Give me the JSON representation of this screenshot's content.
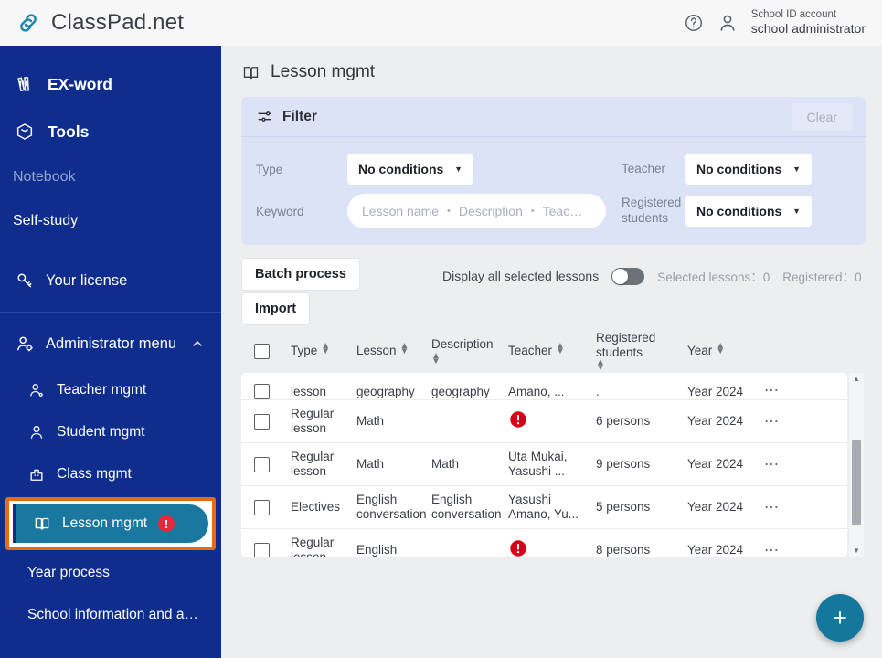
{
  "topbar": {
    "brand_name": "ClassPad.net",
    "help_icon": "help-circle-icon",
    "account_icon": "user-icon",
    "account_type": "School ID account",
    "account_name": "school administrator"
  },
  "sidebar": {
    "primary": [
      {
        "label": "EX-word",
        "icon": "books-icon"
      },
      {
        "label": "Tools",
        "icon": "toolbox-icon"
      }
    ],
    "notebook_label": "Notebook",
    "selfstudy_label": "Self-study",
    "license": {
      "label": "Your license",
      "icon": "key-icon"
    },
    "admin_group": {
      "label": "Administrator menu",
      "icon": "admin-user-icon",
      "chevron": "chevron-up-icon"
    },
    "children": [
      {
        "label": "Teacher mgmt",
        "icon": "teacher-icon"
      },
      {
        "label": "Student mgmt",
        "icon": "student-icon"
      },
      {
        "label": "Class mgmt",
        "icon": "class-icon"
      }
    ],
    "selected": {
      "label": "Lesson mgmt",
      "icon": "book-open-icon",
      "badge": "!"
    },
    "plain": [
      {
        "label": "Year process"
      },
      {
        "label": "School information and a…"
      }
    ]
  },
  "page": {
    "title": "Lesson mgmt",
    "title_icon": "book-open-icon"
  },
  "filter": {
    "icon": "sliders-icon",
    "title": "Filter",
    "clear_label": "Clear",
    "type_label": "Type",
    "type_value": "No conditions",
    "keyword_label": "Keyword",
    "keyword_value": "",
    "keyword_placeholder": "Lesson name ・ Description ・ Teac…",
    "teacher_label": "Teacher",
    "teacher_value": "No conditions",
    "registered_label": "Registered students",
    "registered_value": "No conditions"
  },
  "toolbar": {
    "batch_label": "Batch process",
    "import_label": "Import",
    "display_all_label": "Display all selected lessons",
    "toggle_state": "off",
    "selected_lessons": "Selected lessons：0",
    "registered": "Registered：0"
  },
  "table": {
    "columns": [
      {
        "label": "",
        "key": "checkbox"
      },
      {
        "label": "Type",
        "key": "type",
        "sortable": true
      },
      {
        "label": "Lesson",
        "key": "lesson",
        "sortable": true
      },
      {
        "label": "Description",
        "key": "description",
        "sortable": true
      },
      {
        "label": "Teacher",
        "key": "teacher",
        "sortable": true
      },
      {
        "label": "Registered students",
        "key": "registered",
        "sortable": true
      },
      {
        "label": "Year",
        "key": "year",
        "sortable": true
      },
      {
        "label": "",
        "key": "actions"
      }
    ],
    "rows": [
      {
        "type": "lesson",
        "type_top": "-",
        "lesson": "geography",
        "description": "geography",
        "teacher": "Amano, ...",
        "registered": ".",
        "year": "Year 2024",
        "actions": "…",
        "clipped": true
      },
      {
        "type": "Regular lesson",
        "lesson": "Math",
        "description": "",
        "teacher": "",
        "teacher_error": true,
        "registered": "6 persons",
        "year": "Year 2024",
        "actions": "…"
      },
      {
        "type": "Regular lesson",
        "lesson": "Math",
        "description": "Math",
        "teacher": "Uta Mukai, Yasushi ...",
        "registered": "9 persons",
        "year": "Year 2024",
        "actions": "…"
      },
      {
        "type": "Electives",
        "lesson": "English conversation",
        "description": "English conversation",
        "teacher": "Yasushi Amano, Yu...",
        "registered": "5 persons",
        "year": "Year 2024",
        "actions": "…"
      },
      {
        "type": "Regular lesson",
        "lesson": "English",
        "description": "",
        "teacher": "",
        "teacher_error": true,
        "registered": "8 persons",
        "year": "Year 2024",
        "actions": "…"
      }
    ],
    "scroll_up": "▲",
    "scroll_down": "▼"
  },
  "fab": {
    "icon": "plus-icon",
    "label": "+"
  },
  "colors": {
    "sidebar_bg": "#0f2d8c",
    "selection_border": "#ea6a10",
    "selection_bg": "#1a78a0",
    "filter_bg": "#dde3f7",
    "fab_bg": "#15779c",
    "error_red": "#d60019",
    "brand_teal": "#1a86ab"
  }
}
